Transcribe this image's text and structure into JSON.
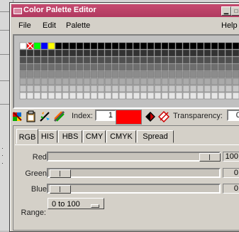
{
  "window": {
    "title": "Color Palette Editor"
  },
  "menu": {
    "items": [
      "File",
      "Edit",
      "Palette"
    ],
    "help": "Help"
  },
  "toolbar": {
    "index_label": "Index:",
    "index_value": "1",
    "transparency_label": "Transparency:",
    "transparency_value": "0",
    "current_color": "#ff0000"
  },
  "tabs": [
    "RGB",
    "HIS",
    "HBS",
    "CMY",
    "CMYK",
    "Spread"
  ],
  "active_tab": "RGB",
  "sliders": [
    {
      "label": "Red:",
      "value": "100",
      "fraction": 1.0
    },
    {
      "label": "Green:",
      "value": "0",
      "fraction": 0.0
    },
    {
      "label": "Blue:",
      "value": "0",
      "fraction": 0.0
    }
  ],
  "range": {
    "label": "Range:",
    "selected": "0 to 100"
  },
  "palette": {
    "first_colors": [
      "#ffffff",
      "#ff0000",
      "#00ff00",
      "#0000ff",
      "#ffff00"
    ],
    "marked_cell_icon": "x-mark-icon"
  },
  "icons": [
    "palette-tool-icon",
    "clipboard-icon",
    "wand-icon",
    "gradient-icon",
    "dropper-icon",
    "eraser-icon"
  ]
}
